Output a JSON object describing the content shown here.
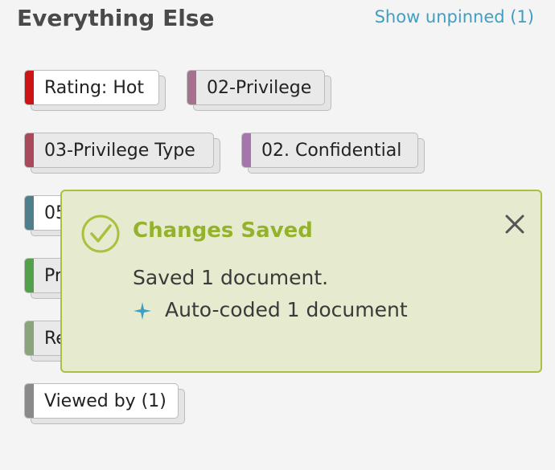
{
  "section": {
    "title": "Everything Else",
    "show_unpinned_label": "Show unpinned (1)"
  },
  "tags": [
    {
      "label": "Rating: Hot",
      "color": "#cc1414",
      "face": "white"
    },
    {
      "label": "02-Privilege",
      "color": "#a5728e",
      "face": "gray"
    },
    {
      "label": "03-Privilege Type",
      "color": "#a8495c",
      "face": "gray"
    },
    {
      "label": "02. Confidential",
      "color": "#a675ad",
      "face": "gray"
    },
    {
      "label": "05",
      "color": "#4e7f8a",
      "face": "white"
    },
    {
      "label": "Pr",
      "color": "#52a04a",
      "face": "gray"
    },
    {
      "label": "Re",
      "color": "#8aa47c",
      "face": "gray"
    },
    {
      "label": "Viewed by (1)",
      "color": "#8a8a8a",
      "face": "white"
    }
  ],
  "toast": {
    "title": "Changes Saved",
    "line1": "Saved 1 document.",
    "line2": "Auto-coded 1 document",
    "icons": [
      "check-circle-icon",
      "close-icon",
      "sparkle-icon"
    ],
    "colors": {
      "title": "#95b22c",
      "background": "#e6ebcf",
      "border": "#a9c13e",
      "sparkle": "#3f9fc2"
    }
  }
}
